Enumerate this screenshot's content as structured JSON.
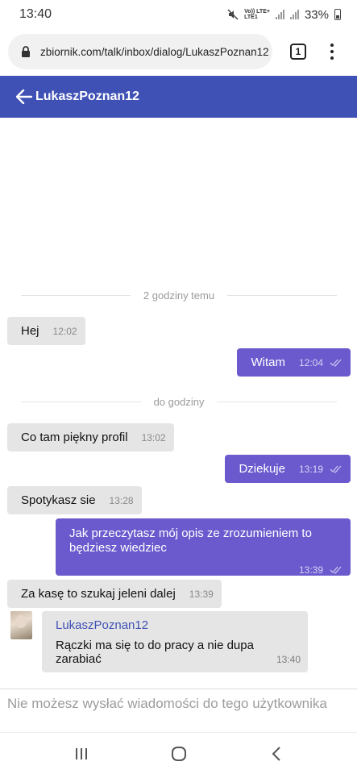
{
  "status_bar": {
    "time": "13:40",
    "network_top": "Vo)) LTE+",
    "network_bottom": "LTE1",
    "battery": "33%"
  },
  "browser": {
    "url": "zbiornik.com/talk/inbox/dialog/LukaszPoznan12",
    "tab_count": "1"
  },
  "header": {
    "title": "LukaszPoznan12"
  },
  "dividers": [
    "2 godziny temu",
    "do godziny"
  ],
  "messages": [
    {
      "dir": "in",
      "text": "Hej",
      "time": "12:02"
    },
    {
      "dir": "out",
      "text": "Witam",
      "time": "12:04"
    },
    {
      "dir": "in",
      "text": "Co tam piękny profil",
      "time": "13:02"
    },
    {
      "dir": "out",
      "text": "Dziekuje",
      "time": "13:19"
    },
    {
      "dir": "in",
      "text": "Spotykasz sie",
      "time": "13:28"
    },
    {
      "dir": "out",
      "text": "Jak przeczytasz mój opis ze zrozumieniem to będziesz wiedziec",
      "time": "13:39"
    },
    {
      "dir": "in",
      "text": "Za kasę to szukaj jeleni dalej",
      "time": "13:39"
    }
  ],
  "last_card": {
    "sender": "LukaszPoznan12",
    "text": "Rączki ma się to do pracy a nie dupa zarabiać",
    "time": "13:40"
  },
  "composer": {
    "notice": "Nie możesz wysłać wiadomości do tego użytkownika"
  },
  "colors": {
    "header": "#3f51b5",
    "outgoing": "#6a5acd",
    "incoming": "#e5e5e5"
  }
}
